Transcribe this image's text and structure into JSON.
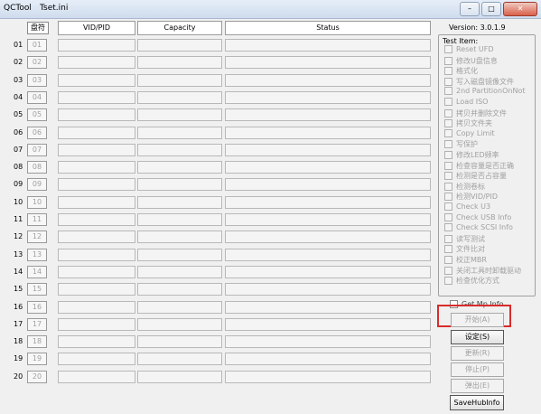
{
  "window": {
    "app_name": "QCTool",
    "file_name": "Tset.ini",
    "buttons": {
      "minimize": "–",
      "maximize": "□",
      "close": "✕"
    }
  },
  "table": {
    "disk_header": "盘符",
    "columns": [
      "VID/PID",
      "Capacity",
      "Status"
    ],
    "rows": [
      {
        "label": "01",
        "button": "01"
      },
      {
        "label": "02",
        "button": "02"
      },
      {
        "label": "03",
        "button": "03"
      },
      {
        "label": "04",
        "button": "04"
      },
      {
        "label": "05",
        "button": "05"
      },
      {
        "label": "06",
        "button": "06"
      },
      {
        "label": "07",
        "button": "07"
      },
      {
        "label": "08",
        "button": "08"
      },
      {
        "label": "09",
        "button": "09"
      },
      {
        "label": "10",
        "button": "10"
      },
      {
        "label": "11",
        "button": "11"
      },
      {
        "label": "12",
        "button": "12"
      },
      {
        "label": "13",
        "button": "13"
      },
      {
        "label": "14",
        "button": "14"
      },
      {
        "label": "15",
        "button": "15"
      },
      {
        "label": "16",
        "button": "16"
      },
      {
        "label": "17",
        "button": "17"
      },
      {
        "label": "18",
        "button": "18"
      },
      {
        "label": "19",
        "button": "19"
      },
      {
        "label": "20",
        "button": "20"
      }
    ]
  },
  "sidebar": {
    "version": "Version: 3.0.1.9",
    "test_item_title": "Test Item:",
    "test_items": [
      "Reset UFD",
      "修改U盘信息",
      "格式化",
      "写入磁盘镜像文件",
      "2nd PartitionOnNot",
      "Load ISO",
      "拷贝并删除文件",
      "拷贝文件夹",
      "Copy Limit",
      "写保护",
      "修改LED频率",
      "检查容量是否正确",
      "检测是否占容量",
      "检测卷标",
      "检测VID/PID",
      "Check U3",
      "Check USB Info",
      "Check SCSI Info",
      "读写测试",
      "文件比对",
      "校正MBR",
      "关闭工具时卸载驱动",
      "检查优化方式"
    ],
    "get_mp_info": "Get Mp Info",
    "buttons": {
      "start": "开始(A)",
      "settings": "设定(S)",
      "update": "更新(R)",
      "stop": "停止(P)",
      "eject": "弹出(E)",
      "save_hub_info": "SaveHubInfo"
    }
  }
}
